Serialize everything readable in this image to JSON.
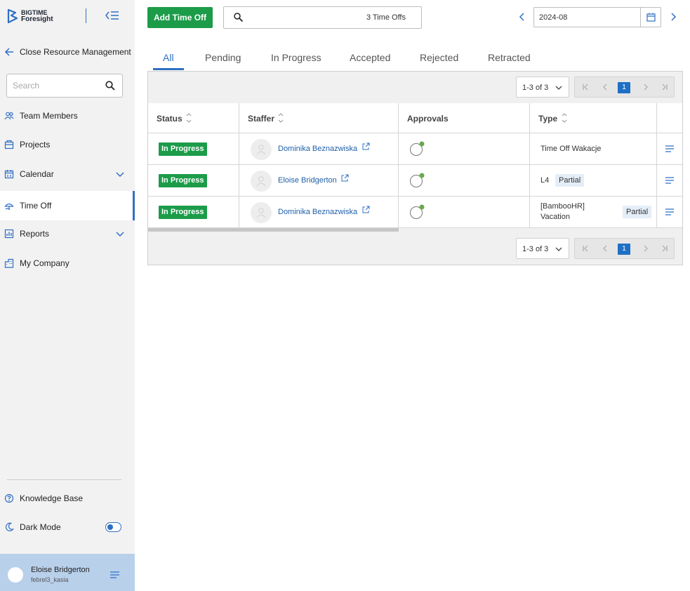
{
  "brand": {
    "line1": "BIGTIME",
    "line2": "Foresight",
    "color": "#2f6fc4"
  },
  "sidebar": {
    "back_label": "Close Resource Management",
    "search_placeholder": "Search",
    "items": [
      {
        "label": "Team Members",
        "icon": "team-icon"
      },
      {
        "label": "Projects",
        "icon": "projects-icon"
      },
      {
        "label": "Calendar",
        "icon": "calendar-icon",
        "expandable": true
      },
      {
        "label": "Time Off",
        "icon": "time-off-icon",
        "active": true
      },
      {
        "label": "Reports",
        "icon": "reports-icon",
        "expandable": true
      },
      {
        "label": "My Company",
        "icon": "company-icon"
      }
    ],
    "knowledge_base": "Knowledge Base",
    "dark_mode": "Dark Mode",
    "dark_mode_on": true,
    "user": {
      "name": "Eloise Bridgerton",
      "sub": "febrel3_kasia"
    }
  },
  "toolbar": {
    "add_label": "Add Time Off",
    "search_count": "3 Time Offs",
    "date_value": "2024-08"
  },
  "tabs": [
    "All",
    "Pending",
    "In Progress",
    "Accepted",
    "Rejected",
    "Retracted"
  ],
  "active_tab": "All",
  "pager": {
    "range": "1-3 of 3",
    "page": "1"
  },
  "table": {
    "columns": [
      "Status",
      "Staffer",
      "Approvals",
      "Type"
    ],
    "rows": [
      {
        "status": "In Progress",
        "staffer": "Dominika Beznazwiska",
        "type_line1": "Time Off Wakacje",
        "type_line2": "",
        "partial": ""
      },
      {
        "status": "In Progress",
        "staffer": "Eloise Bridgerton",
        "type_line1": "L4",
        "type_line2": "",
        "partial": "Partial"
      },
      {
        "status": "In Progress",
        "staffer": "Dominika Beznazwiska",
        "type_line1": "[BambooHR]",
        "type_line2": "Vacation",
        "partial": "Partial"
      }
    ]
  },
  "colors": {
    "accent": "#2f6fc4",
    "success": "#1c9c49",
    "approval_dot": "#6aa84f"
  }
}
